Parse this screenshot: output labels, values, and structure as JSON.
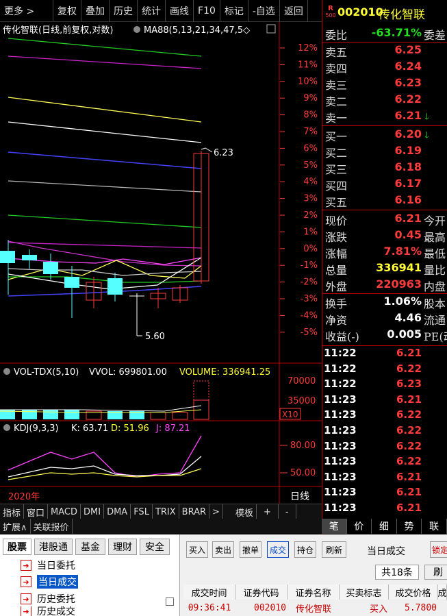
{
  "toolbar": {
    "items": [
      "更多 >",
      "复权",
      "叠加",
      "历史",
      "统计",
      "画线",
      "F10",
      "标记",
      "-自选",
      "返回"
    ]
  },
  "chart": {
    "title": "传化智联(日线,前复权,对数)",
    "ma_label": "MA88(5,13,21,34,47,5◇",
    "pct_ticks": [
      "12%",
      "11%",
      "10%",
      "9%",
      "8%",
      "7%",
      "6%",
      "5%",
      "4%",
      "3%",
      "2%",
      "1%",
      "0%",
      "-1%",
      "-2%",
      "-3%",
      "-4%",
      "-5%"
    ],
    "high_label": "6.23",
    "low_label": "5.60",
    "vol_label": "VOL-TDX(5,10)",
    "vvol_label": "VVOL: 699801.00",
    "volume_label": "VOLUME: 336941.25",
    "vol_ticks": [
      "70000",
      "35000"
    ],
    "vol_unit": "X10",
    "kdj_label": "KDJ(9,3,3)",
    "kdj_k": "K: 63.71",
    "kdj_d": "D: 51.96",
    "kdj_j": "J: 87.21",
    "kdj_ticks": [
      "80.00",
      "50.00"
    ],
    "year_label": "2020年",
    "period_label": "日线"
  },
  "bottom_tabs": [
    "指标",
    "窗口",
    "MACD",
    "DMI",
    "DMA",
    "FSL",
    "TRIX",
    "BRAR",
    ">",
    "模板",
    "+",
    "-"
  ],
  "bottom_tabs2": [
    "扩展∧",
    "关联报价"
  ],
  "quote": {
    "badge_top": "R",
    "badge_bottom": "500",
    "code": "002010",
    "name": "传化智联",
    "weibi_label": "委比",
    "weibi_value": "-63.71%",
    "weicha_label": "委差",
    "sells": [
      {
        "label": "卖五",
        "price": "6.25"
      },
      {
        "label": "卖四",
        "price": "6.24"
      },
      {
        "label": "卖三",
        "price": "6.23"
      },
      {
        "label": "卖二",
        "price": "6.22"
      },
      {
        "label": "卖一",
        "price": "6.21"
      }
    ],
    "buys": [
      {
        "label": "买一",
        "price": "6.20"
      },
      {
        "label": "买二",
        "price": "6.19"
      },
      {
        "label": "买三",
        "price": "6.18"
      },
      {
        "label": "买四",
        "price": "6.17"
      },
      {
        "label": "买五",
        "price": "6.16"
      }
    ],
    "stats": [
      {
        "label": "现价",
        "value": "6.21",
        "label2": "今开",
        "color": "red"
      },
      {
        "label": "涨跌",
        "value": "0.45",
        "label2": "最高",
        "color": "red"
      },
      {
        "label": "涨幅",
        "value": "7.81%",
        "label2": "最低",
        "color": "red"
      },
      {
        "label": "总量",
        "value": "336941",
        "label2": "量比",
        "color": "yellow"
      },
      {
        "label": "外盘",
        "value": "220963",
        "label2": "内盘",
        "color": "red"
      }
    ],
    "stats2": [
      {
        "label": "换手",
        "value": "1.06%",
        "label2": "股本",
        "color": "white"
      },
      {
        "label": "净资",
        "value": "4.46",
        "label2": "流通",
        "color": "white"
      },
      {
        "label": "收益(-)",
        "value": "0.005",
        "label2": "PE(动",
        "color": "white"
      }
    ],
    "ticks": [
      {
        "time": "11:22",
        "price": "6.21"
      },
      {
        "time": "11:22",
        "price": "6.22"
      },
      {
        "time": "11:22",
        "price": "6.23"
      },
      {
        "time": "11:23",
        "price": "6.21"
      },
      {
        "time": "11:23",
        "price": "6.22"
      },
      {
        "time": "11:23",
        "price": "6.22"
      },
      {
        "time": "11:23",
        "price": "6.22"
      },
      {
        "time": "11:23",
        "price": "6.22"
      },
      {
        "time": "11:23",
        "price": "6.21"
      },
      {
        "time": "11:23",
        "price": "6.21"
      },
      {
        "time": "11:23",
        "price": "6.21"
      }
    ],
    "tabs": [
      "笔",
      "价",
      "细",
      "势",
      "联"
    ]
  },
  "trade": {
    "left_tabs": [
      "股票",
      "港股通",
      "基金",
      "理财",
      "安全"
    ],
    "tree": [
      "当日委托",
      "当日成交",
      "历史委托",
      "历史成交"
    ],
    "buttons": [
      "买入",
      "卖出",
      "撤单",
      "成交",
      "持仓",
      "刷新"
    ],
    "panel_title": "当日成交",
    "lock_label": "锁定",
    "count_label": "共18条",
    "refresh_label": "刷",
    "headers": [
      "成交时间",
      "证券代码",
      "证券名称",
      "买卖标志",
      "成交价格",
      "成"
    ],
    "row": {
      "time": "09:36:41",
      "code": "002010",
      "name": "传化智联",
      "side": "买入",
      "price": "5.7800"
    }
  },
  "colors": {
    "up": "#ff3b3b",
    "down": "#22dd22",
    "yellow": "#ffff33",
    "cyan": "#55ffff",
    "magenta": "#ff44ff"
  }
}
